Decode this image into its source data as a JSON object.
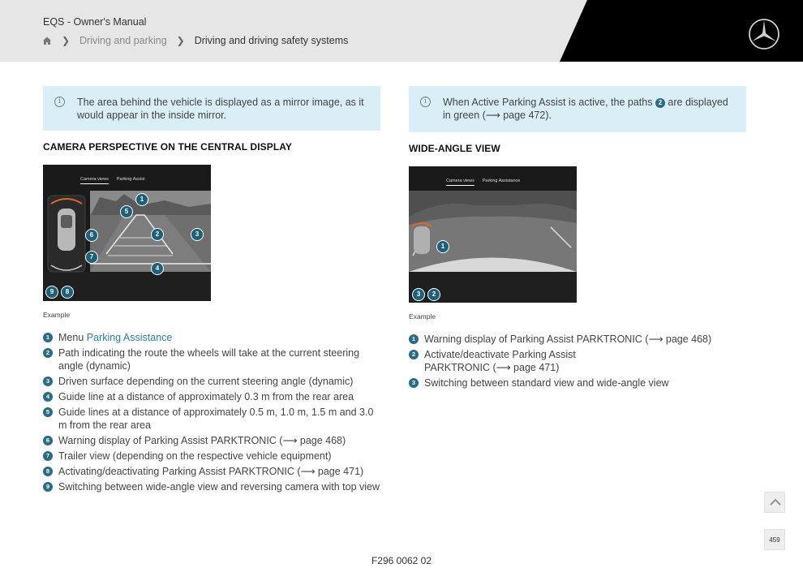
{
  "header": {
    "doc_title": "EQS - Owner's Manual",
    "breadcrumb": [
      {
        "label": "Driving and parking"
      },
      {
        "label": "Driving and driving safety systems"
      }
    ]
  },
  "left": {
    "info_text": "The area behind the vehicle is displayed as a mirror image, as it would appear in the inside mirror.",
    "section_title": "CAMERA PERSPECTIVE ON THE CENTRAL DISPLAY",
    "screen": {
      "tab_camera": "Camera views",
      "tab_parking": "Parking Assist"
    },
    "callouts": [
      "1",
      "5",
      "6",
      "2",
      "3",
      "7",
      "4",
      "9",
      "8"
    ],
    "example": "Example",
    "legend": [
      {
        "num": "1",
        "text": "Menu ",
        "link": "Parking Assistance"
      },
      {
        "num": "2",
        "text": "Path indicating the route the wheels will take at the current steering angle (dynamic)"
      },
      {
        "num": "3",
        "text": "Driven surface depending on the current steering angle (dynamic)"
      },
      {
        "num": "4",
        "text": "Guide line at a distance of approximately 0.3 m from the rear area"
      },
      {
        "num": "5",
        "text": "Guide lines at a distance of approximately 0.5 m, 1.0 m, 1.5 m and 3.0 m from the rear area"
      },
      {
        "num": "6",
        "text": "Warning display of Parking Assist PARKTRONIC (⟶ page 468)"
      },
      {
        "num": "7",
        "text": "Trailer view (depending on the respective vehicle equipment)"
      },
      {
        "num": "8",
        "text": "Activating/deactivating Parking Assist PARKTRONIC (⟶ page 471)"
      },
      {
        "num": "9",
        "text": "Switching between wide-angle view and reversing camera with top view"
      }
    ]
  },
  "right": {
    "info_before": "When Active Parking Assist is active, the paths ",
    "info_num": "2",
    "info_after": " are displayed in green (⟶ page 472).",
    "section_title": "WIDE-ANGLE VIEW",
    "screen": {
      "tab_camera": "Camera views",
      "tab_parking": "Parking Assistance"
    },
    "callouts": [
      "1",
      "3",
      "2"
    ],
    "example": "Example",
    "legend": [
      {
        "num": "1",
        "text": "Warning display of Parking Assist PARKTRONIC (⟶ page 468)"
      },
      {
        "num": "2",
        "text": "Activate/deactivate Parking Assist PARKTRONIC (⟶ page 471)"
      },
      {
        "num": "3",
        "text": "Switching between standard view and wide-angle view"
      }
    ]
  },
  "footer": {
    "code": "F296 0062 02",
    "page_badge": "459"
  },
  "icons": {
    "home": "home-icon",
    "chevron": "chevron-right-icon",
    "info": "info-icon",
    "scroll_up": "chevron-up-icon",
    "logo": "mercedes-star-logo"
  }
}
